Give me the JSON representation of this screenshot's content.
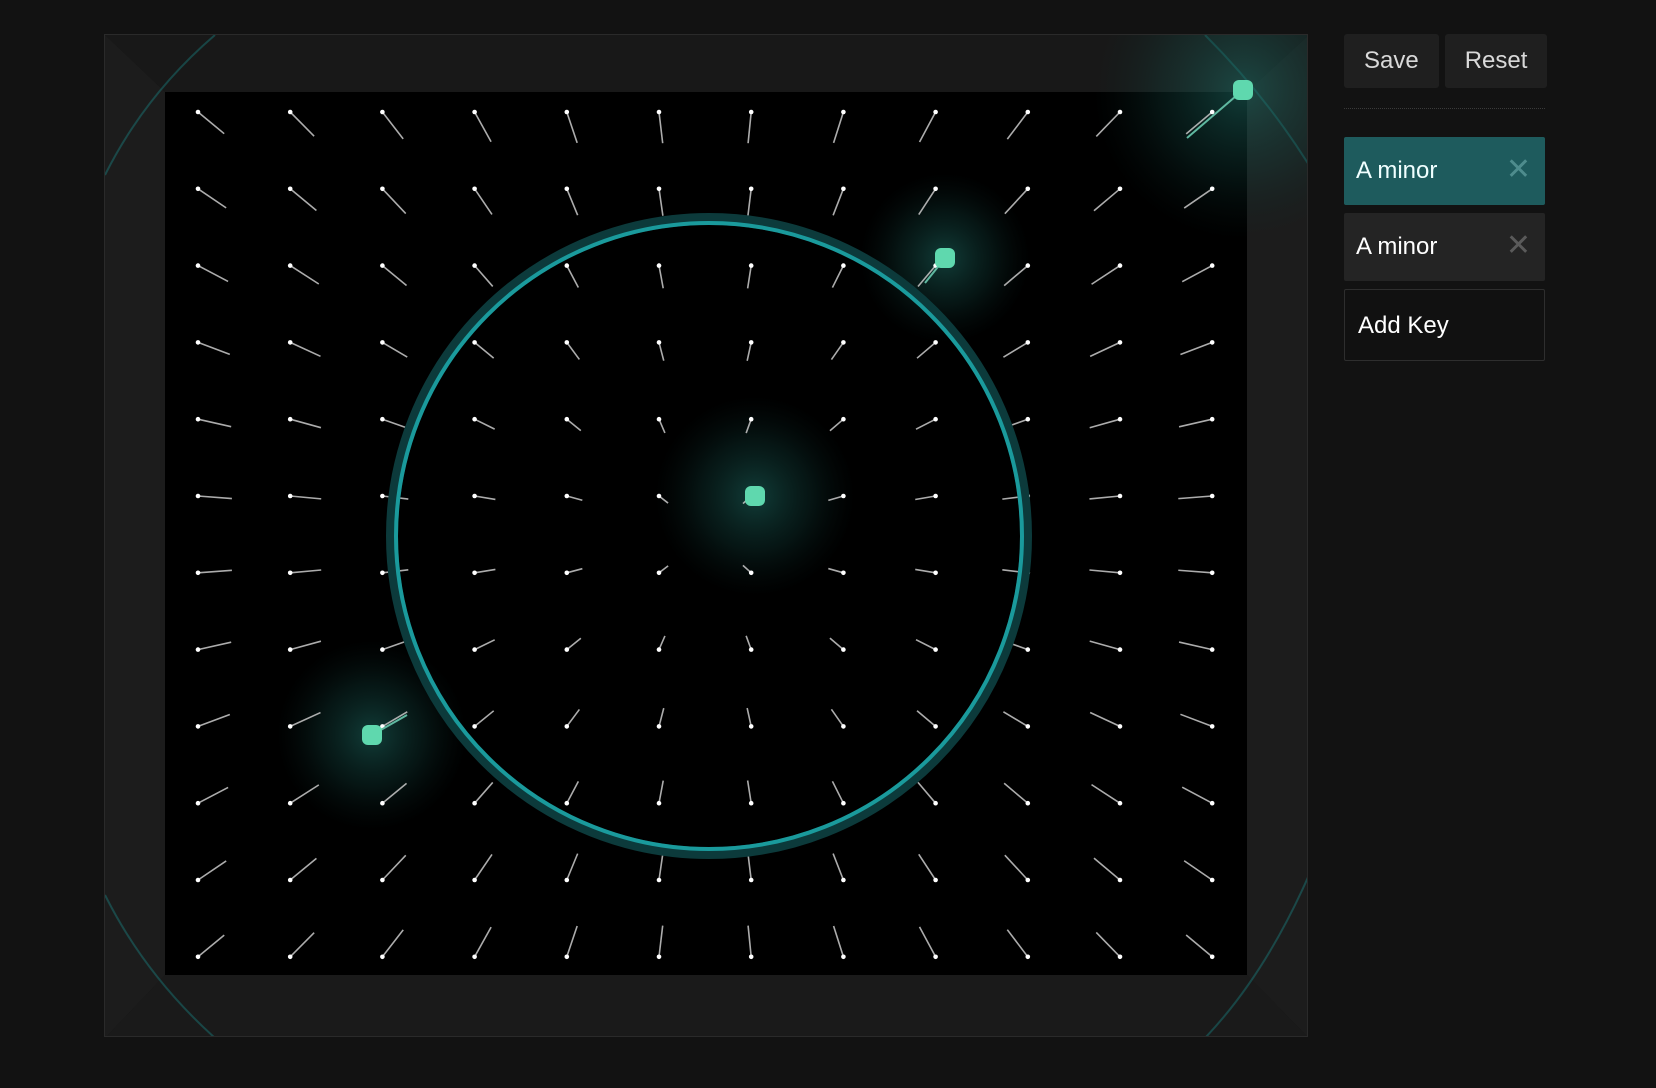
{
  "toolbar": {
    "save_label": "Save",
    "reset_label": "Reset"
  },
  "keys": [
    {
      "label": "A minor",
      "active": true,
      "remove_icon": "close-icon"
    },
    {
      "label": "A minor",
      "active": false,
      "remove_icon": "close-icon"
    }
  ],
  "add_key_label": "Add Key",
  "colors": {
    "page_background": "#121212",
    "field_background": "#000000",
    "accent": "#1a9a9c",
    "handle": "#5fd8ae",
    "active_key": "#1e5b5d"
  }
}
